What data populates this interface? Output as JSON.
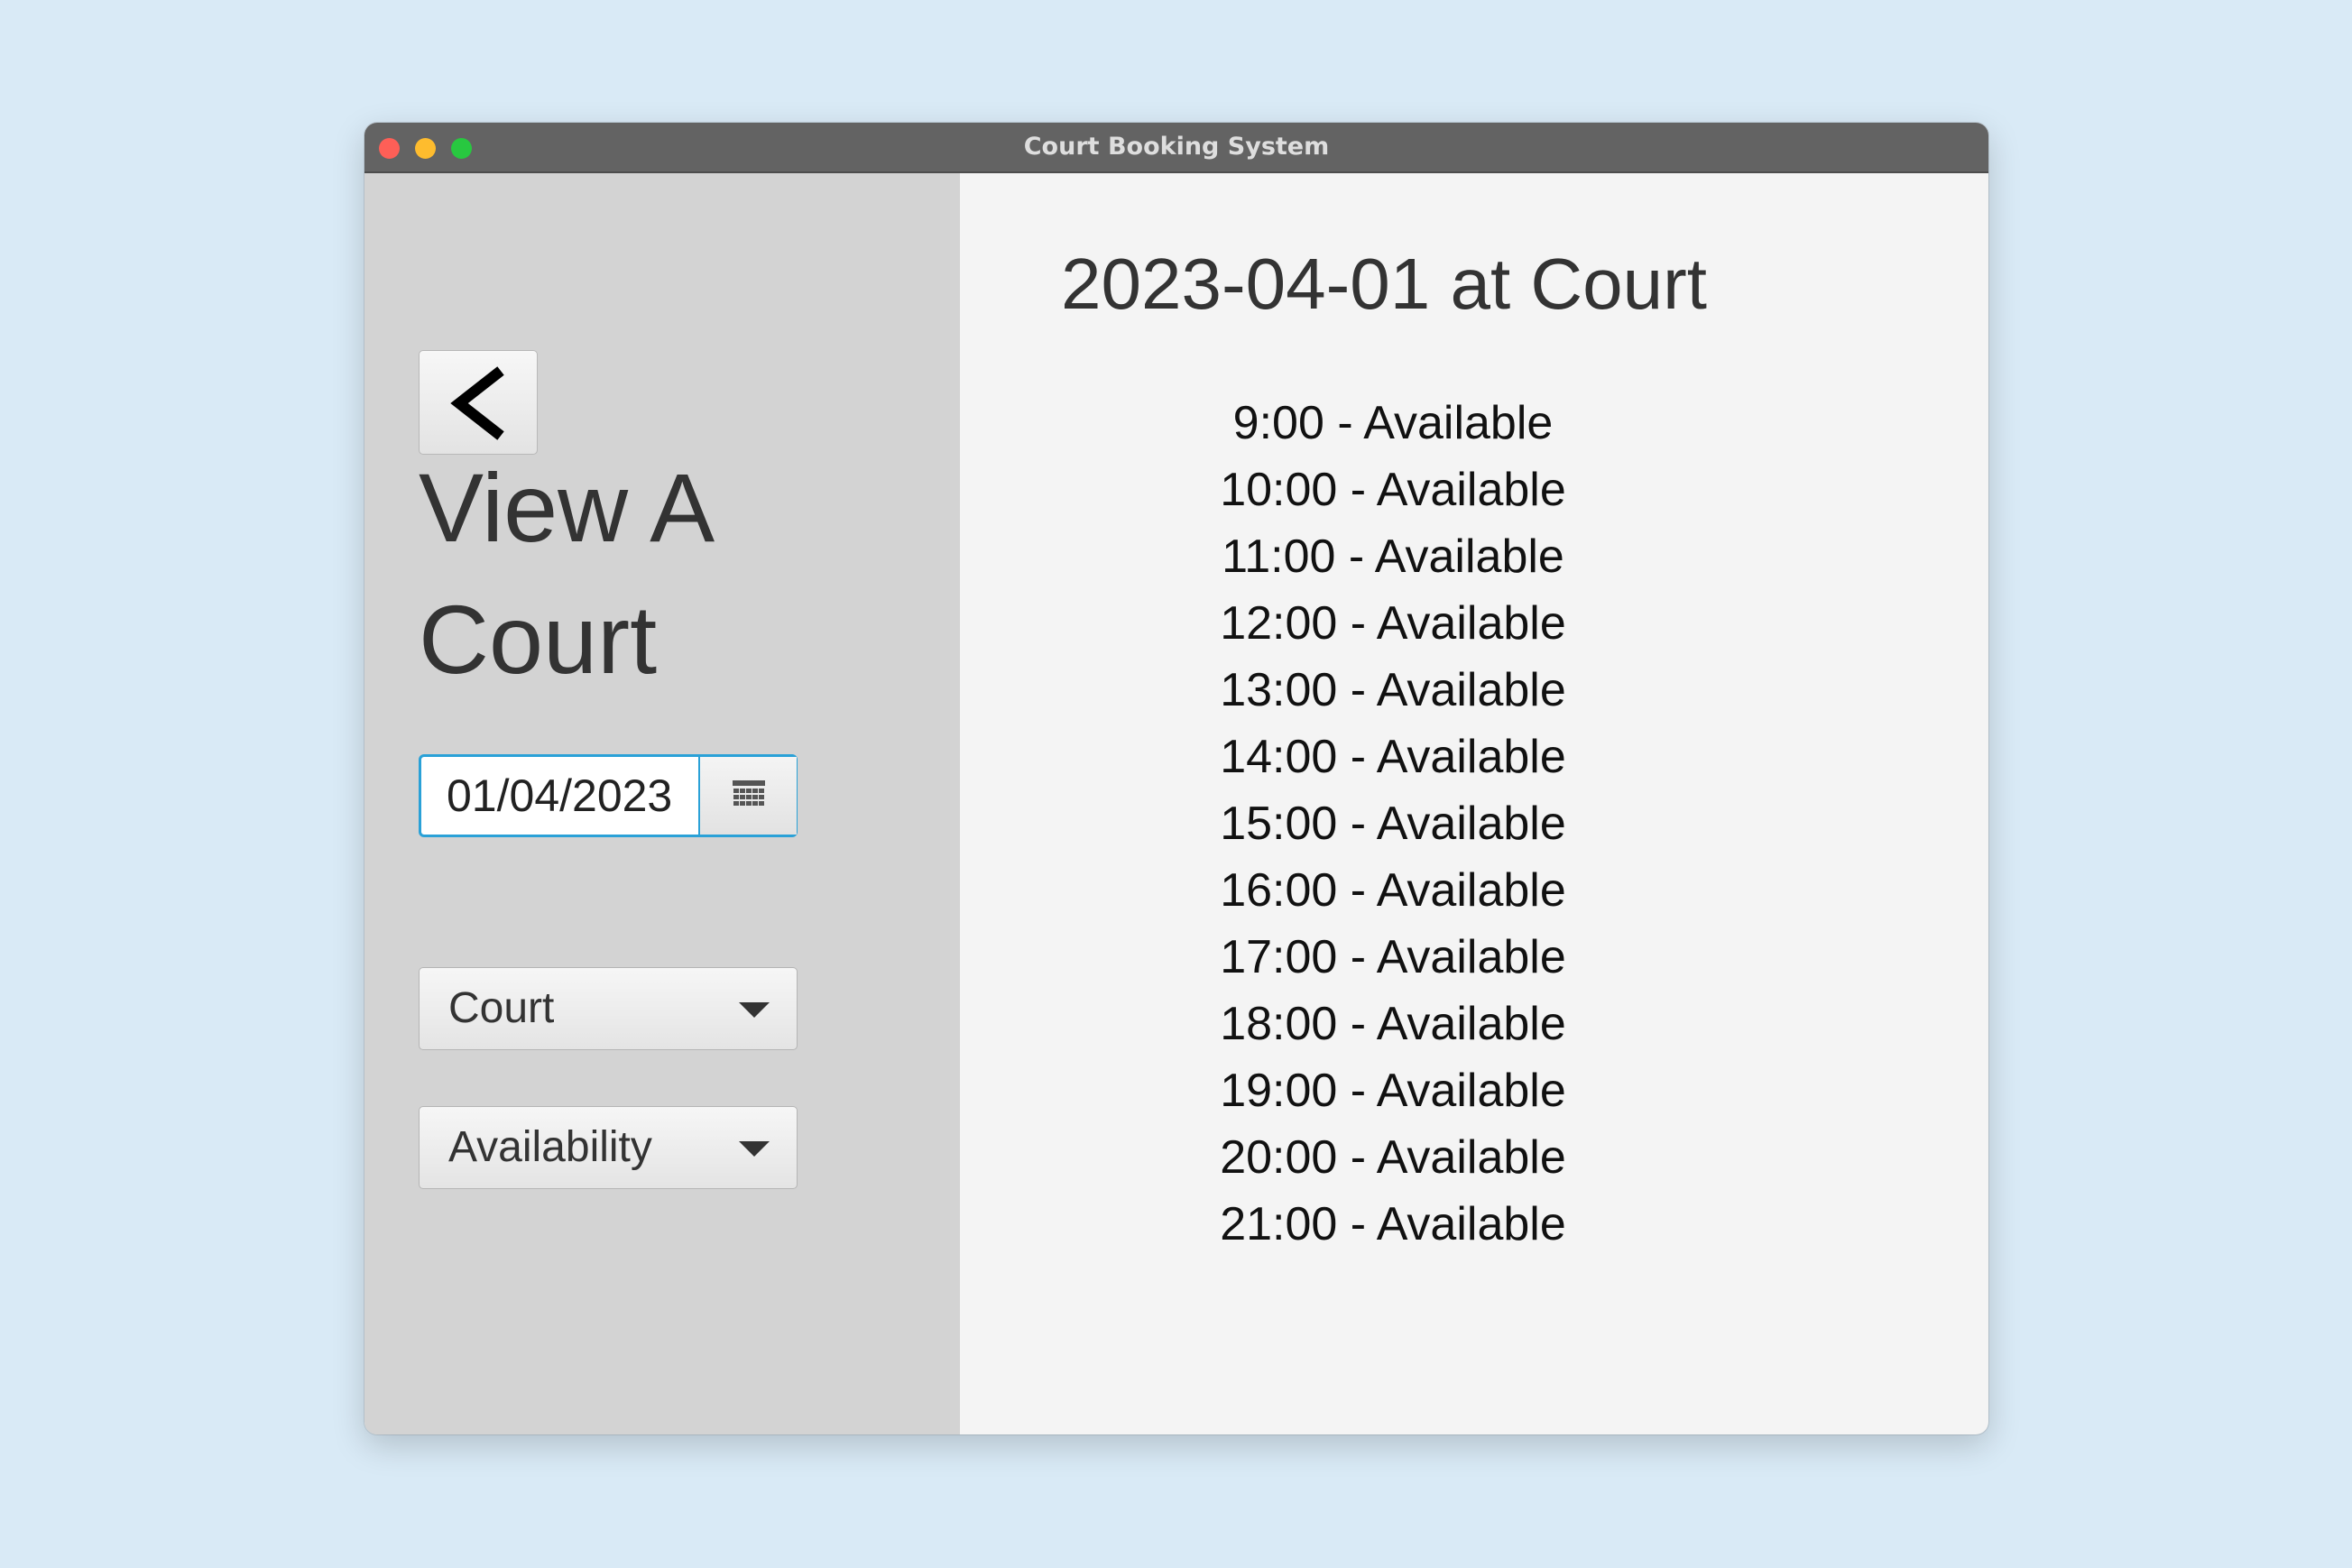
{
  "window": {
    "title": "Court Booking System"
  },
  "sidebar": {
    "back_icon": "chevron-left-icon",
    "title": "View A Court",
    "date_picker": {
      "value": "01/04/2023",
      "icon": "calendar-icon"
    },
    "court_combo": {
      "label": "Court",
      "icon": "chevron-down-icon"
    },
    "availability_combo": {
      "label": "Availability",
      "icon": "chevron-down-icon"
    }
  },
  "main": {
    "heading": "2023-04-01 at Court",
    "slots": [
      "9:00 - Available",
      "10:00 - Available",
      "11:00 - Available",
      "12:00 - Available",
      "13:00 - Available",
      "14:00 - Available",
      "15:00 - Available",
      "16:00 - Available",
      "17:00 - Available",
      "18:00 - Available",
      "19:00 - Available",
      "20:00 - Available",
      "21:00 - Available"
    ]
  },
  "colors": {
    "desktop_background": "#d9eaf6",
    "titlebar": "#636363",
    "sidebar": "#d3d3d3",
    "main_background": "#f4f4f4",
    "focus_accent": "#2aa1d7"
  }
}
